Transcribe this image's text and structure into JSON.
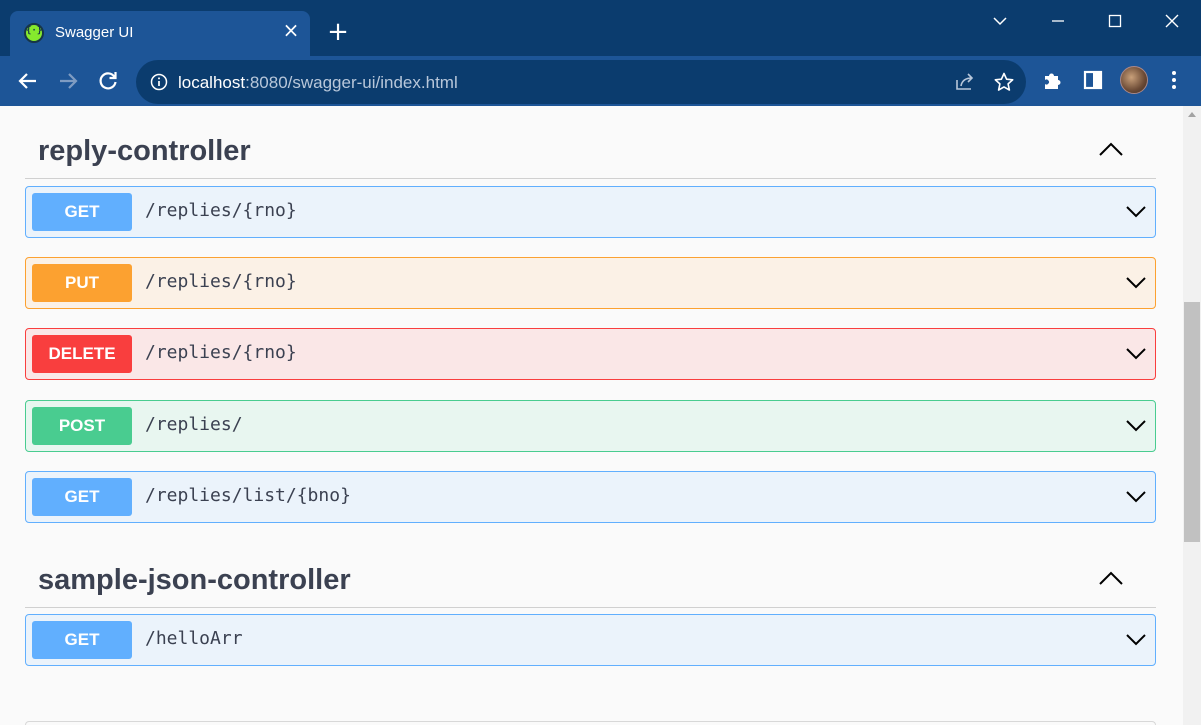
{
  "browser": {
    "tab_title": "Swagger UI",
    "tab_close": "×",
    "new_tab": "+",
    "url_host": "localhost",
    "url_rest": ":8080/swagger-ui/index.html"
  },
  "icons": {
    "favicon": "swagger-favicon-icon",
    "back": "arrow-left-icon",
    "forward": "arrow-right-icon",
    "reload": "reload-icon",
    "site_info": "info-circle-icon",
    "share": "share-icon",
    "bookmark": "star-icon",
    "extensions": "puzzle-icon",
    "side_panel": "side-panel-icon",
    "menu": "kebab-menu-icon",
    "collapse": "chevron-up-icon",
    "expand": "chevron-down-icon"
  },
  "colors": {
    "get": "#61affe",
    "put": "#fca130",
    "delete": "#f93e3e",
    "post": "#49cc90",
    "title_text": "#3b4151"
  },
  "sections": [
    {
      "title": "reply-controller",
      "operations": [
        {
          "method": "GET",
          "path": "/replies/{rno}"
        },
        {
          "method": "PUT",
          "path": "/replies/{rno}"
        },
        {
          "method": "DELETE",
          "path": "/replies/{rno}"
        },
        {
          "method": "POST",
          "path": "/replies/"
        },
        {
          "method": "GET",
          "path": "/replies/list/{bno}"
        }
      ]
    },
    {
      "title": "sample-json-controller",
      "operations": [
        {
          "method": "GET",
          "path": "/helloArr"
        }
      ]
    }
  ]
}
